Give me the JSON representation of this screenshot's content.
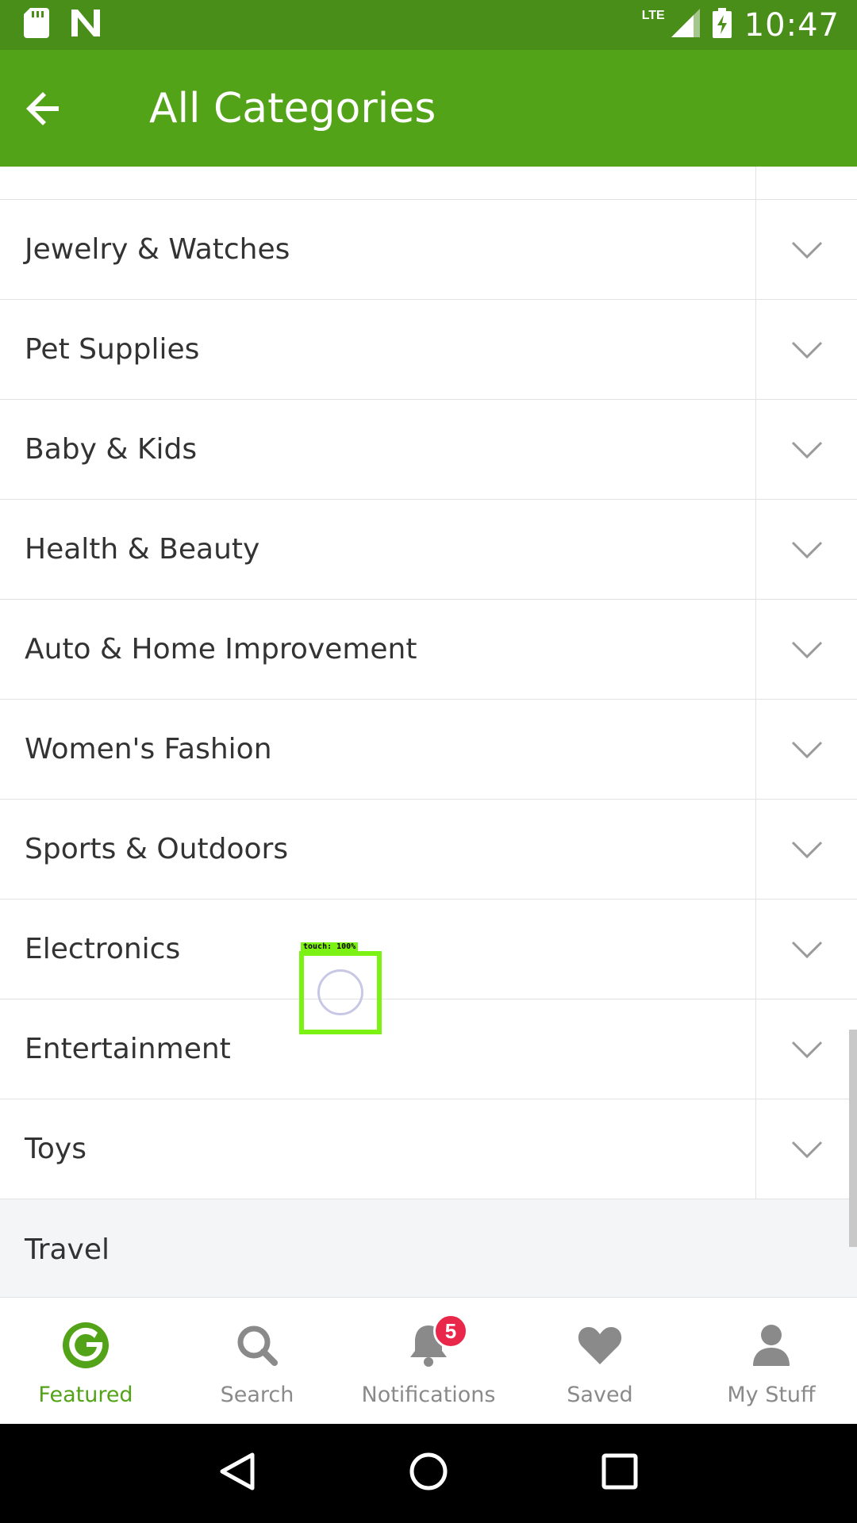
{
  "status_bar": {
    "network": "LTE",
    "time": "10:47"
  },
  "app_bar": {
    "title": "All Categories"
  },
  "categories": [
    {
      "label": "Jewelry & Watches"
    },
    {
      "label": "Pet Supplies"
    },
    {
      "label": "Baby & Kids"
    },
    {
      "label": "Health & Beauty"
    },
    {
      "label": "Auto & Home Improvement"
    },
    {
      "label": "Women's Fashion"
    },
    {
      "label": "Sports & Outdoors"
    },
    {
      "label": "Electronics"
    },
    {
      "label": "Entertainment"
    },
    {
      "label": "Toys"
    }
  ],
  "travel": {
    "label": "Travel"
  },
  "touch_indicator": {
    "label": "touch: 100%"
  },
  "bottom_nav": {
    "items": [
      {
        "label": "Featured",
        "icon": "groupon-g-icon",
        "active": true
      },
      {
        "label": "Search",
        "icon": "search-icon"
      },
      {
        "label": "Notifications",
        "icon": "bell-icon",
        "badge": "5"
      },
      {
        "label": "Saved",
        "icon": "heart-icon"
      },
      {
        "label": "My Stuff",
        "icon": "person-icon"
      }
    ]
  },
  "colors": {
    "status_bar": "#4a8e1a",
    "app_bar": "#53a318",
    "accent": "#53a318",
    "badge": "#e8274b"
  }
}
